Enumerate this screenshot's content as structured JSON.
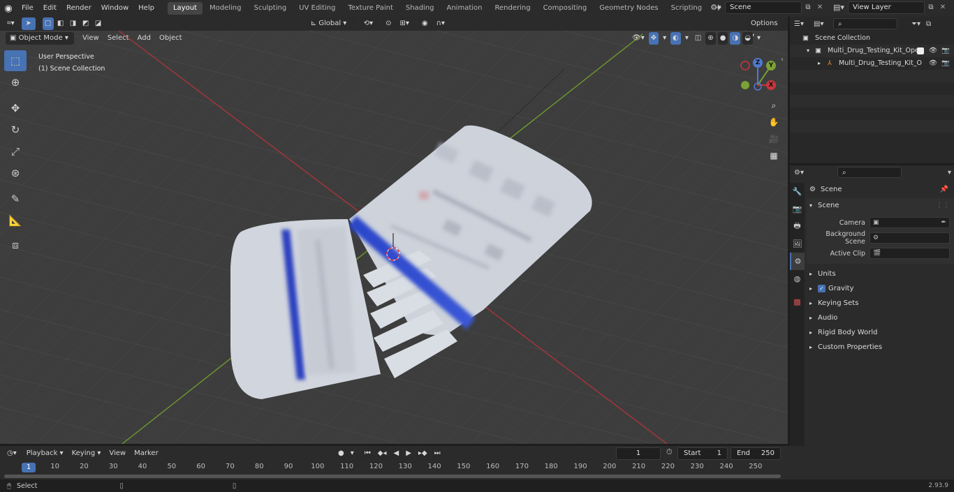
{
  "menu": [
    "File",
    "Edit",
    "Render",
    "Window",
    "Help"
  ],
  "workspaces": [
    "Layout",
    "Modeling",
    "Sculpting",
    "UV Editing",
    "Texture Paint",
    "Shading",
    "Animation",
    "Rendering",
    "Compositing",
    "Geometry Nodes",
    "Scripting"
  ],
  "active_workspace": "Layout",
  "scene_name": "Scene",
  "view_layer": "View Layer",
  "viewport": {
    "mode": "Object Mode",
    "menus": [
      "View",
      "Select",
      "Add",
      "Object"
    ],
    "transform_orientation": "Global",
    "options_label": "Options",
    "info_line1": "User Perspective",
    "info_line2": "(1) Scene Collection",
    "gizmo_z": "Z",
    "gizmo_y": "Y",
    "gizmo_x": "X"
  },
  "outliner": {
    "root": "Scene Collection",
    "items": [
      {
        "label": "Multi_Drug_Testing_Kit_Open"
      },
      {
        "label": "Multi_Drug_Testing_Kit_O"
      }
    ]
  },
  "properties": {
    "context": "Scene",
    "section": "Scene",
    "fields": [
      {
        "label": "Camera"
      },
      {
        "label": "Background Scene"
      },
      {
        "label": "Active Clip"
      }
    ],
    "panels": [
      "Units",
      "Gravity",
      "Keying Sets",
      "Audio",
      "Rigid Body World",
      "Custom Properties"
    ]
  },
  "timeline": {
    "menus": [
      "Playback",
      "Keying",
      "View",
      "Marker"
    ],
    "current_frame": "1",
    "start_label": "Start",
    "start": "1",
    "end_label": "End",
    "end": "250",
    "ticks": [
      "10",
      "20",
      "30",
      "40",
      "50",
      "60",
      "70",
      "80",
      "90",
      "100",
      "110",
      "120",
      "130",
      "140",
      "150",
      "160",
      "170",
      "180",
      "190",
      "200",
      "210",
      "220",
      "230",
      "240",
      "250"
    ],
    "current_marker": "1"
  },
  "status": {
    "left": "Select",
    "version": "2.93.9"
  },
  "colors": {
    "accent": "#4772b3",
    "x_axis": "#c8363c",
    "y_axis": "#7aa33a"
  }
}
